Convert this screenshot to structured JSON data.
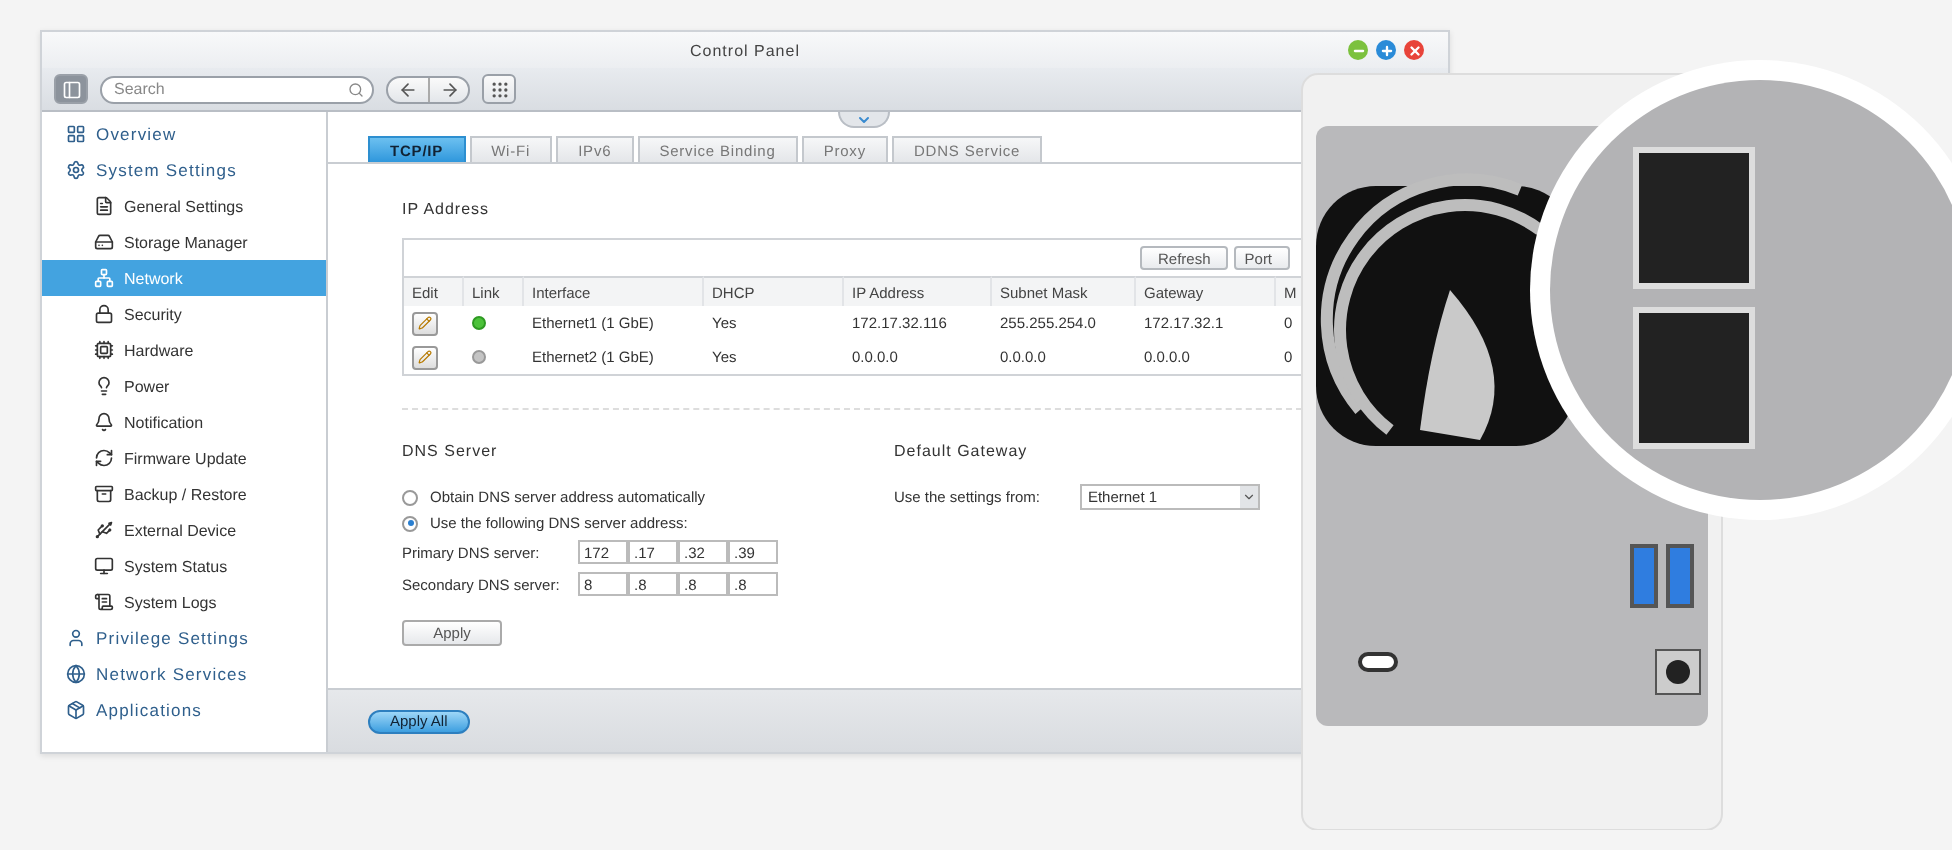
{
  "window": {
    "title": "Control Panel"
  },
  "toolbar": {
    "search": {
      "placeholder": "Search"
    }
  },
  "sidebar": {
    "items": [
      {
        "label": "Overview",
        "selected": false
      },
      {
        "label": "System Settings",
        "selected": false,
        "children": [
          {
            "label": "General Settings",
            "selected": false
          },
          {
            "label": "Storage Manager",
            "selected": false
          },
          {
            "label": "Network",
            "selected": true
          },
          {
            "label": "Security",
            "selected": false
          },
          {
            "label": "Hardware",
            "selected": false
          },
          {
            "label": "Power",
            "selected": false
          },
          {
            "label": "Notification",
            "selected": false
          },
          {
            "label": "Firmware Update",
            "selected": false
          },
          {
            "label": "Backup / Restore",
            "selected": false
          },
          {
            "label": "External Device",
            "selected": false
          },
          {
            "label": "System Status",
            "selected": false
          },
          {
            "label": "System Logs",
            "selected": false
          }
        ]
      },
      {
        "label": "Privilege Settings",
        "selected": false
      },
      {
        "label": "Network Services",
        "selected": false
      },
      {
        "label": "Applications",
        "selected": false
      }
    ]
  },
  "tabs": [
    {
      "label": "TCP/IP",
      "selected": true
    },
    {
      "label": "Wi-Fi",
      "selected": false
    },
    {
      "label": "IPv6",
      "selected": false
    },
    {
      "label": "Service Binding",
      "selected": false
    },
    {
      "label": "Proxy",
      "selected": false
    },
    {
      "label": "DDNS Service",
      "selected": false
    }
  ],
  "ip_address": {
    "title": "IP Address",
    "buttons": [
      "Refresh",
      "Port"
    ],
    "columns": [
      "Edit",
      "Link",
      "Interface",
      "DHCP",
      "IP Address",
      "Subnet Mask",
      "Gateway",
      "M"
    ],
    "rows": [
      {
        "connected": true,
        "interface": "Ethernet1 (1 GbE)",
        "dhcp": "Yes",
        "ip": "172.17.32.116",
        "mask": "255.255.254.0",
        "gateway": "172.17.32.1",
        "column_8": "0"
      },
      {
        "connected": false,
        "interface": "Ethernet2 (1 GbE)",
        "dhcp": "Yes",
        "ip": "0.0.0.0",
        "mask": "0.0.0.0",
        "gateway": "0.0.0.0",
        "column_8": "0"
      }
    ]
  },
  "dns_server": {
    "title": "DNS Server",
    "options": [
      {
        "label": "Obtain DNS server address automatically",
        "selected": false
      },
      {
        "label": "Use the following DNS server address:",
        "selected": true
      }
    ],
    "servers": [
      {
        "label": "Primary DNS server:",
        "octets": [
          {
            "value": "172"
          },
          {
            "prefix": ".",
            "value": "17"
          },
          {
            "prefix": ".",
            "value": "32"
          },
          {
            "prefix": ".",
            "value": "39"
          }
        ]
      },
      {
        "label": "Secondary DNS server:",
        "octets": [
          {
            "value": "8"
          },
          {
            "prefix": ".",
            "value": "8"
          },
          {
            "prefix": ".",
            "value": "8"
          },
          {
            "prefix": ".",
            "value": "8"
          }
        ]
      }
    ],
    "apply": "Apply"
  },
  "default_gateway": {
    "title": "Default Gateway",
    "label": "Use the settings from:",
    "value": "Ethernet 1"
  },
  "footer": {
    "apply_all": "Apply All"
  }
}
